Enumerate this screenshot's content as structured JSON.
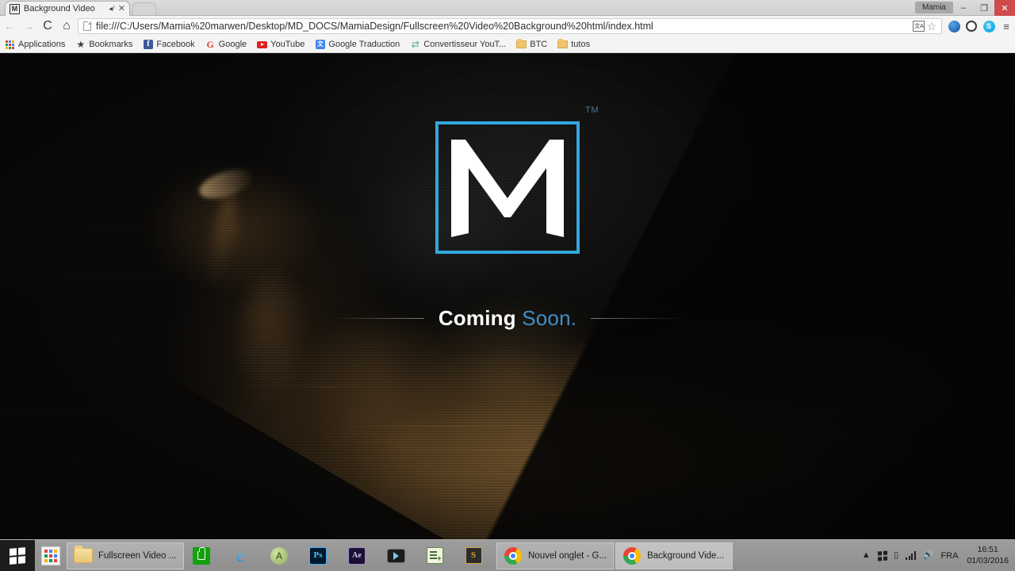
{
  "browser": {
    "tab": {
      "favicon_letter": "M",
      "title": "Background Video",
      "audio_icon": "◂⁾",
      "close_icon": "✕"
    },
    "window_controls": {
      "user_label": "Mamia",
      "minimize": "–",
      "maximize": "❐",
      "close": "✕"
    },
    "nav": {
      "back_icon": "←",
      "forward_icon": "→",
      "reload_icon": "C",
      "home_icon": "⌂"
    },
    "omnibox": {
      "url": "file:///C:/Users/Mamia%20marwen/Desktop/MD_DOCS/MamiaDesign/Fullscreen%20Video%20Background%20html/index.html",
      "translate_icon_label": "文A",
      "bookmark_star_icon": "☆"
    },
    "extensions": [
      {
        "name": "blue-globe-extension-icon",
        "label": ""
      },
      {
        "name": "opera-extension-icon",
        "label": ""
      },
      {
        "name": "skype-extension-icon",
        "label": "S"
      }
    ],
    "menu_icon": "≡",
    "bookmarks": [
      {
        "label": "Applications",
        "icon": "apps-grid-icon"
      },
      {
        "label": "Bookmarks",
        "icon": "star-icon"
      },
      {
        "label": "Facebook",
        "icon": "facebook-icon"
      },
      {
        "label": "Google",
        "icon": "google-icon"
      },
      {
        "label": "YouTube",
        "icon": "youtube-icon"
      },
      {
        "label": "Google Traduction",
        "icon": "google-translate-icon"
      },
      {
        "label": "Convertisseur YouT...",
        "icon": "converter-icon"
      },
      {
        "label": "BTC",
        "icon": "folder-icon"
      },
      {
        "label": "tutos",
        "icon": "folder-icon"
      }
    ]
  },
  "page": {
    "logo": {
      "letter": "M",
      "trademark": "TM",
      "border_color": "#34a6dd",
      "letter_color": "#ffffff"
    },
    "tagline": {
      "primary": "Coming",
      "secondary": "Soon.",
      "primary_color": "#fdfdfd",
      "secondary_color": "#3d90c9"
    },
    "background": {
      "description": "fullscreen dark smoke video background",
      "smoke_color": "#c48c42",
      "base_color": "#090807"
    }
  },
  "taskbar": {
    "start_icon": "windows-logo-icon",
    "apps_grid_icon": "apps-grid-icon",
    "items": [
      {
        "label": "Fullscreen Video ...",
        "icon": "folder-icon",
        "type": "window"
      },
      {
        "label": "",
        "icon": "windows-store-icon",
        "type": "pinned"
      },
      {
        "label": "",
        "icon": "internet-explorer-icon",
        "type": "pinned"
      },
      {
        "label": "",
        "icon": "android-studio-icon",
        "type": "pinned"
      },
      {
        "label": "",
        "icon": "photoshop-icon",
        "type": "pinned"
      },
      {
        "label": "",
        "icon": "after-effects-icon",
        "type": "pinned"
      },
      {
        "label": "",
        "icon": "video-player-icon",
        "type": "pinned"
      },
      {
        "label": "",
        "icon": "notepad-editor-icon",
        "type": "pinned"
      },
      {
        "label": "",
        "icon": "sublime-text-icon",
        "type": "pinned"
      },
      {
        "label": "Nouvel onglet - G...",
        "icon": "chrome-icon",
        "type": "window"
      },
      {
        "label": "Background Vide...",
        "icon": "chrome-icon",
        "type": "window-active"
      }
    ],
    "tray": {
      "overflow_icon": "▲",
      "action_center_icon": "windows-flag-icon",
      "device_icon": "device-icon",
      "network_icon": "signal-bars-icon",
      "volume_icon": "🔊",
      "language": "FRA",
      "time": "16:51",
      "date": "01/03/2016"
    }
  }
}
